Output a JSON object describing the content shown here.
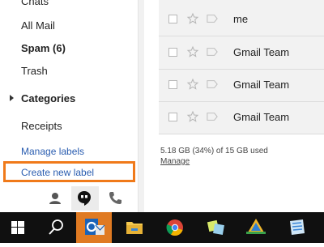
{
  "sidebar": {
    "items": [
      {
        "label": "Chats"
      },
      {
        "label": "All Mail"
      },
      {
        "label": "Spam (6)"
      },
      {
        "label": "Trash"
      },
      {
        "label": "Categories"
      },
      {
        "label": "Receipts"
      }
    ],
    "manage_labels": "Manage labels",
    "create_new_label": "Create new label"
  },
  "hangouts": {
    "icons": [
      "person-icon",
      "hangouts-quote-icon",
      "phone-icon"
    ]
  },
  "emails": [
    {
      "sender": "me"
    },
    {
      "sender": "Gmail Team"
    },
    {
      "sender": "Gmail Team"
    },
    {
      "sender": "Gmail Team"
    }
  ],
  "storage": {
    "usage": "5.18 GB (34%) of 15 GB used",
    "manage": "Manage"
  },
  "taskbar": {
    "icons": [
      "windows-start-icon",
      "search-icon",
      "outlook-icon",
      "file-explorer-icon",
      "chrome-icon",
      "sticky-notes-icon",
      "app-icon",
      "app-icon-2"
    ]
  },
  "colors": {
    "highlight": "#f07a1a",
    "link": "#2a5db0",
    "taskbar": "#101010"
  }
}
